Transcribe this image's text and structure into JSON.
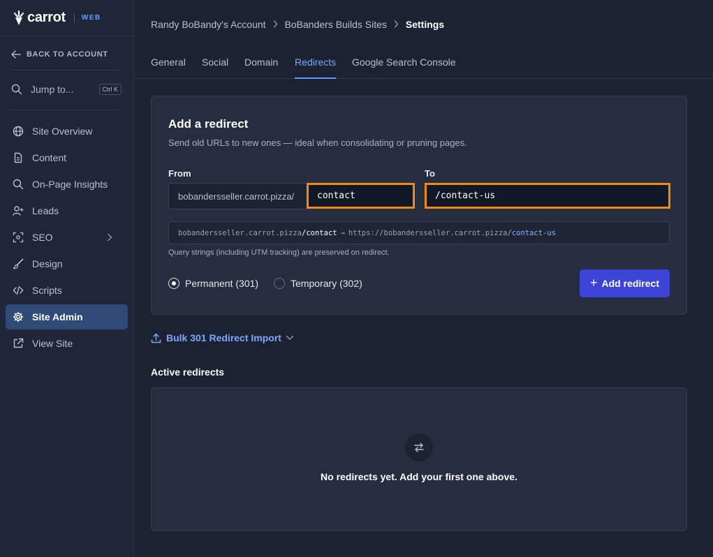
{
  "brand": {
    "name": "carrot",
    "product": "WEB"
  },
  "sidebar": {
    "back_label": "BACK TO ACCOUNT",
    "jump_label": "Jump to...",
    "jump_shortcut": "Ctrl K",
    "items": [
      {
        "label": "Site Overview",
        "icon": "globe-icon"
      },
      {
        "label": "Content",
        "icon": "document-icon"
      },
      {
        "label": "On-Page Insights",
        "icon": "search-icon"
      },
      {
        "label": "Leads",
        "icon": "user-plus-icon"
      },
      {
        "label": "SEO",
        "icon": "target-icon"
      },
      {
        "label": "Design",
        "icon": "brush-icon"
      },
      {
        "label": "Scripts",
        "icon": "code-icon"
      },
      {
        "label": "Site Admin",
        "icon": "gear-icon",
        "active": true
      },
      {
        "label": "View Site",
        "icon": "external-link-icon"
      }
    ]
  },
  "breadcrumb": {
    "account": "Randy BoBandy's Account",
    "site": "BoBanders Builds Sites",
    "current": "Settings"
  },
  "tabs": [
    {
      "label": "General"
    },
    {
      "label": "Social"
    },
    {
      "label": "Domain"
    },
    {
      "label": "Redirects",
      "active": true
    },
    {
      "label": "Google Search Console"
    }
  ],
  "redirect_form": {
    "title": "Add a redirect",
    "subtitle": "Send old URLs to new ones — ideal when consolidating or pruning pages.",
    "from_label": "From",
    "to_label": "To",
    "from_prefix": "bobandersseller.carrot.pizza/",
    "from_value": "contact",
    "to_value": "/contact-us",
    "preview": {
      "from_domain": "bobandersseller.carrot.pizza",
      "from_path": "/contact",
      "arrow": "→",
      "to_domain": "https://bobandersseller.carrot.pizza",
      "to_path": "/contact-us"
    },
    "note": "Query strings (including UTM tracking) are preserved on redirect.",
    "options": [
      {
        "label": "Permanent (301)",
        "selected": true
      },
      {
        "label": "Temporary (302)",
        "selected": false
      }
    ],
    "add_button": "Add redirect"
  },
  "bulk_import": {
    "label": "Bulk 301 Redirect Import"
  },
  "active_redirects": {
    "title": "Active redirects",
    "empty_text": "No redirects yet. Add your first one above."
  },
  "colors": {
    "accent": "#3b44d6",
    "link": "#7ea6ff",
    "highlight_border": "#f08a12",
    "active_nav": "#2f4a76"
  }
}
